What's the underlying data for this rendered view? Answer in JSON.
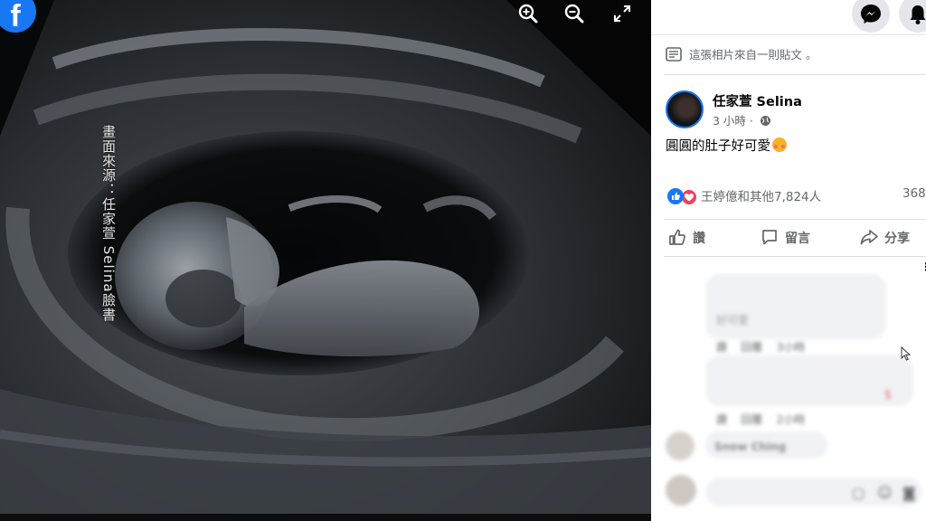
{
  "viewer": {
    "credit": "畫面來源：任家萱 Selina臉書",
    "tools": [
      "zoom-in-icon",
      "zoom-out-icon",
      "fullscreen-icon"
    ]
  },
  "panel": {
    "top_buttons": [
      "messenger-icon",
      "notifications-icon"
    ],
    "post_note": "這張相片來自一則貼文 。",
    "author": "任家萱 Selina",
    "time": "3 小時 ·",
    "caption": "圓圓的肚子好可愛",
    "reactions_text": "王婷億和其他7,824人",
    "comment_count": "368",
    "actions": {
      "like": "讚",
      "comment": "留言",
      "share": "分享"
    },
    "comments": [
      {
        "snippet": "好可愛",
        "meta": [
          "讚",
          "回覆",
          "3小時"
        ]
      },
      {
        "reaction_count": "5",
        "meta": [
          "讚",
          "回覆",
          "2小時"
        ]
      },
      {
        "name": "Snow Ching"
      }
    ]
  },
  "colors": {
    "facebook_blue": "#1877f2",
    "text_primary": "#050505",
    "text_secondary": "#65676b",
    "love_red": "#f33e58"
  }
}
